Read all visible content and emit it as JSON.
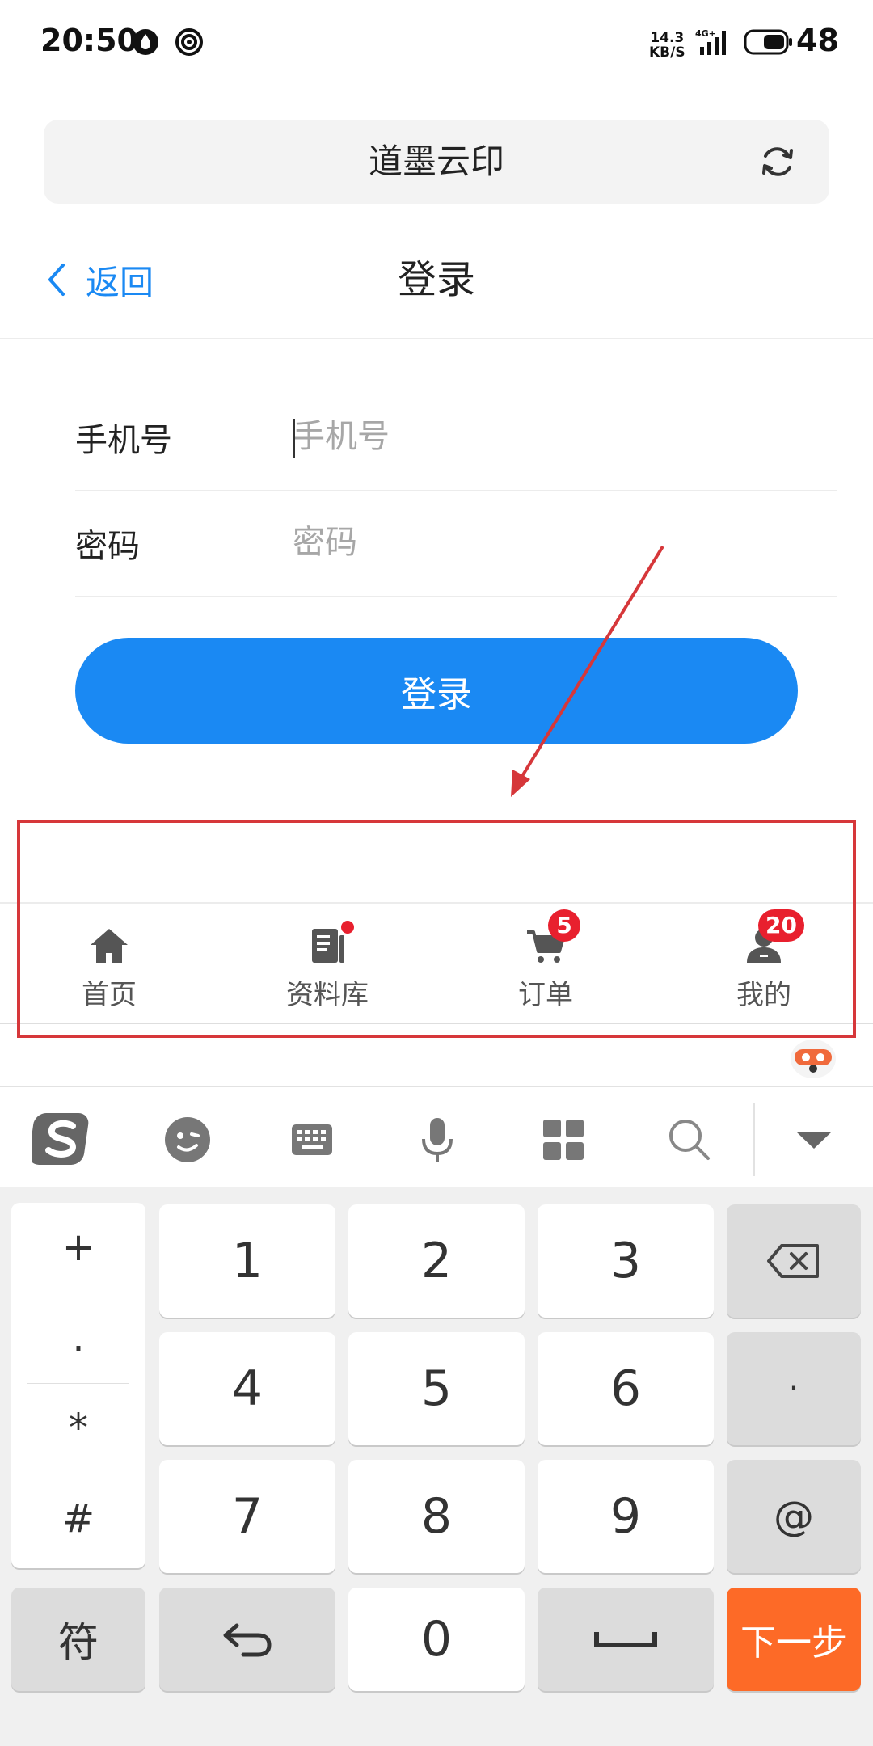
{
  "status_bar": {
    "time": "20:50",
    "speed": "14.3\nKB/S",
    "network": "4G+",
    "battery": "48"
  },
  "browser": {
    "title": "道墨云印"
  },
  "header": {
    "back_label": "返回",
    "title": "登录"
  },
  "form": {
    "phone_label": "手机号",
    "phone_placeholder": "手机号",
    "phone_value": "",
    "password_label": "密码",
    "password_placeholder": "密码",
    "password_value": ""
  },
  "login_button": "登录",
  "tab_bar": {
    "items": [
      {
        "label": "首页",
        "icon": "home-icon"
      },
      {
        "label": "资料库",
        "icon": "document-icon",
        "dot": true
      },
      {
        "label": "订单",
        "icon": "cart-icon",
        "badge": "5"
      },
      {
        "label": "我的",
        "icon": "user-icon",
        "badge": "20"
      }
    ]
  },
  "keyboard": {
    "symbols": [
      "+",
      ".",
      "*",
      "#"
    ],
    "digits": [
      "1",
      "2",
      "3",
      "4",
      "5",
      "6",
      "7",
      "8",
      "9",
      "0"
    ],
    "dot_key": "·",
    "at_key": "@",
    "fu_key": "符",
    "next_key": "下一步"
  },
  "colors": {
    "accent": "#1a89f3",
    "annotation": "#d6373a",
    "badge": "#e8202e",
    "next_key": "#fd6a27"
  }
}
